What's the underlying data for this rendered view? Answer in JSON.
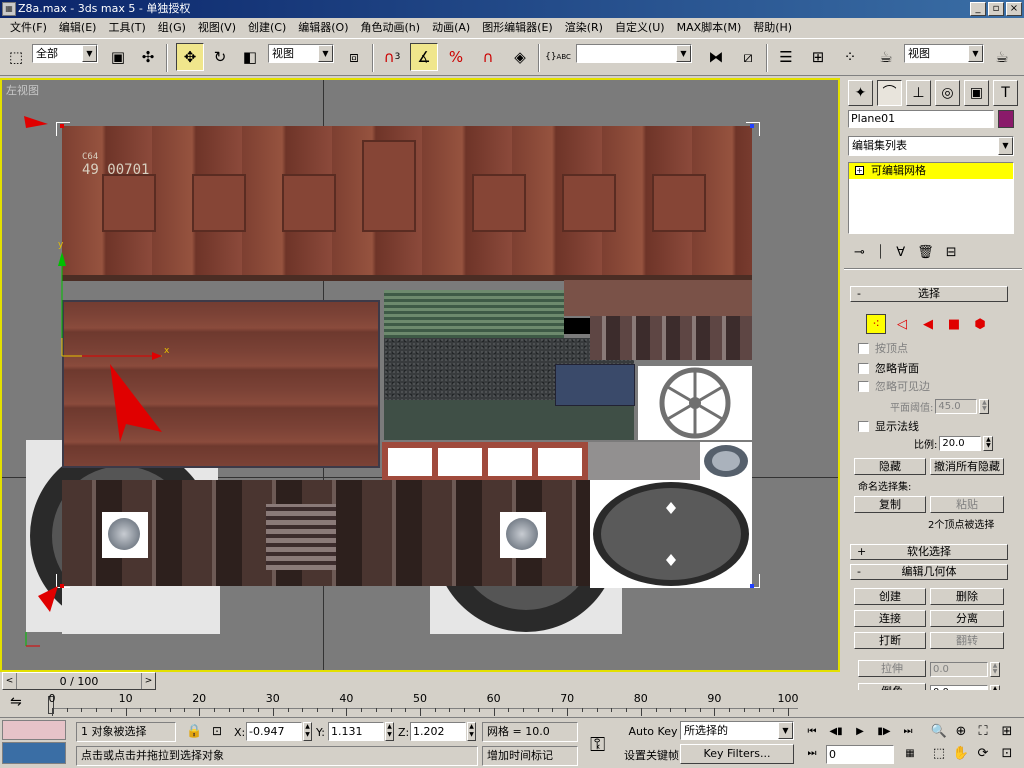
{
  "window": {
    "title": "Z8a.max - 3ds max 5 - 单独授权",
    "icon": "max-app-icon",
    "min": "_",
    "max": "▫",
    "close": "×"
  },
  "menu": [
    "文件(F)",
    "编辑(E)",
    "工具(T)",
    "组(G)",
    "视图(V)",
    "创建(C)",
    "编辑器(O)",
    "角色动画(h)",
    "动画(A)",
    "图形编辑器(E)",
    "渲染(R)",
    "自定义(U)",
    "MAX脚本(M)",
    "帮助(H)"
  ],
  "toolbar": {
    "selection_filter": "全部",
    "ref_coord": "视图",
    "named_sel_set": "",
    "render_type": "视图",
    "abc_label": "ABC",
    "snap_num": "3"
  },
  "viewport": {
    "label": "左视图",
    "car_mark": "49 00701",
    "car_mark_small": "C64",
    "gizmo_x": "x",
    "gizmo_y": "y"
  },
  "command_panel": {
    "object_name": "Plane01",
    "object_color": "#8a1a6a",
    "modifier_list": "编辑集列表",
    "stack_item": "可编辑网格",
    "selection_rollout": {
      "title": "选择",
      "by_vertex": "按顶点",
      "ignore_backfacing": "忽略背面",
      "ignore_visible_edges": "忽略可见边",
      "planar_threshold_label": "平面阈值:",
      "planar_threshold": "45.0",
      "show_normals": "显示法线",
      "scale_label": "比例:",
      "scale": "20.0",
      "hide": "隐藏",
      "unhide_all": "撤消所有隐藏",
      "named_sel_label": "命名选择集:",
      "copy": "复制",
      "paste": "粘贴",
      "selected_info": "2个顶点被选择"
    },
    "soft_selection": "软化选择",
    "edit_geometry": {
      "title": "编辑几何体",
      "create": "创建",
      "delete": "删除",
      "attach": "连接",
      "detach": "分离",
      "break": "打断",
      "turn": "翻转",
      "extrude": "拉伸",
      "extrude_val": "0.0",
      "chamfer": "倒角",
      "chamfer_val": "0.0"
    }
  },
  "timeline": {
    "slider": "0 / 100",
    "prev": "<",
    "next": ">",
    "ticks": [
      "0",
      "10",
      "20",
      "30",
      "40",
      "50",
      "60",
      "70",
      "80",
      "90",
      "100"
    ]
  },
  "status": {
    "selected": "1 对象被选择",
    "prompt": "点击或点击并拖拉到选择对象",
    "x_label": "X:",
    "x": "-0.947",
    "y_label": "Y:",
    "y": "1.131",
    "z_label": "Z:",
    "z": "1.202",
    "grid": "网格 = 10.0",
    "add_time_tag": "增加时间标记",
    "auto_key": "Auto Key",
    "set_key": "设置关键帧",
    "key_mode": "所选择的",
    "key_filters": "Key Filters...",
    "frame": "0"
  }
}
